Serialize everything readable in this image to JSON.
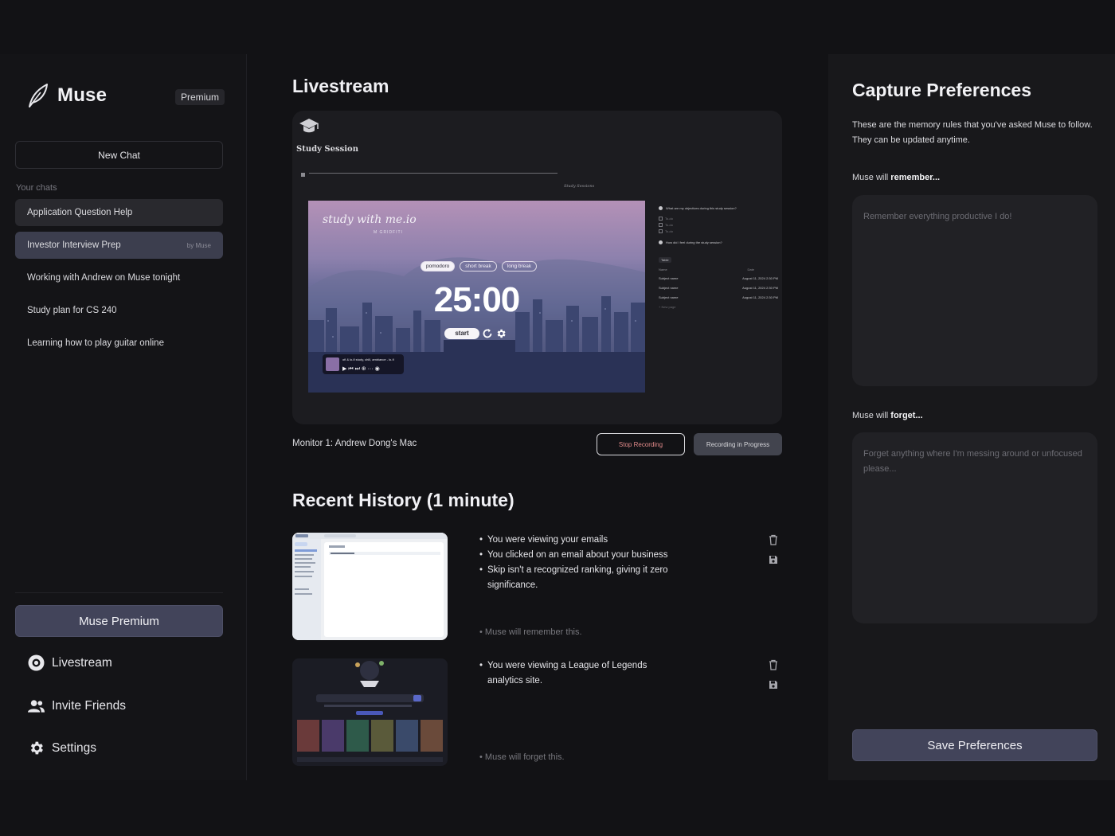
{
  "brand": {
    "name": "Muse",
    "badge": "Premium"
  },
  "sidebar": {
    "new_chat": "New Chat",
    "chats_heading": "Your chats",
    "chats": [
      {
        "label": "Application Question Help",
        "tag": ""
      },
      {
        "label": "Investor Interview Prep",
        "tag": "by Muse"
      },
      {
        "label": "Working with Andrew on Muse tonight",
        "tag": ""
      },
      {
        "label": "Study plan for CS 240",
        "tag": ""
      },
      {
        "label": "Learning how to play guitar online",
        "tag": ""
      }
    ],
    "premium_button": "Muse Premium",
    "nav": {
      "livestream": "Livestream",
      "invite": "Invite Friends",
      "settings": "Settings"
    }
  },
  "main": {
    "livestream_title": "Livestream",
    "stream": {
      "page_title": "Study Session",
      "page_italic": "Study Sessions",
      "video_brand": "study with me.io",
      "video_sub": "M GRIDFITI",
      "modes": [
        "pomodoro",
        "short break",
        "long break"
      ],
      "timer": "25:00",
      "start": "start",
      "music_title": "ofi & lo-fi study, chill, ambiance - lo-fi",
      "music_controls": "▶ ⏮ ⏭ ⊕ ··· ◉",
      "notes": {
        "q1": "What are my objectives during this study session?",
        "todos": [
          "To-do",
          "To-do",
          "To-do"
        ],
        "q2": "How did I feel during the study session?",
        "tab": "Table",
        "col_name": "Name",
        "col_date": "Date",
        "rows": [
          {
            "name": "Subject name",
            "date": "August 11, 2024 2:30 PM"
          },
          {
            "name": "Subject name",
            "date": "August 11, 2024 2:30 PM"
          },
          {
            "name": "Subject name",
            "date": "August 11, 2024 2:30 PM"
          }
        ],
        "new_page": "+ New page"
      }
    },
    "monitor": "Monitor 1: Andrew Dong's Mac",
    "stop_button": "Stop Recording",
    "progress_button": "Recording in Progress",
    "history_title": "Recent History (1 minute)",
    "history": [
      {
        "bullets": [
          "You were viewing your emails",
          "You clicked on an email about your business",
          "Skip isn't a recognized ranking, giving it zero significance."
        ],
        "note": "Muse will remember this."
      },
      {
        "bullets": [
          "You were viewing a League of Legends analytics site."
        ],
        "note": "Muse will forget this."
      }
    ]
  },
  "preferences": {
    "title": "Capture Preferences",
    "description": "These are the memory rules that you've asked Muse to follow. They can be updated anytime.",
    "remember_prefix": "Muse will ",
    "remember_bold": "remember...",
    "remember_placeholder": "Remember everything productive I do!",
    "forget_prefix": "Muse will ",
    "forget_bold": "forget...",
    "forget_placeholder": "Forget anything where I'm messing around or unfocused please...",
    "save_button": "Save Preferences"
  },
  "colors": {
    "accent": "#42445a",
    "background": "#121215",
    "panel": "#18181b",
    "stop_text": "#e28a8a"
  }
}
